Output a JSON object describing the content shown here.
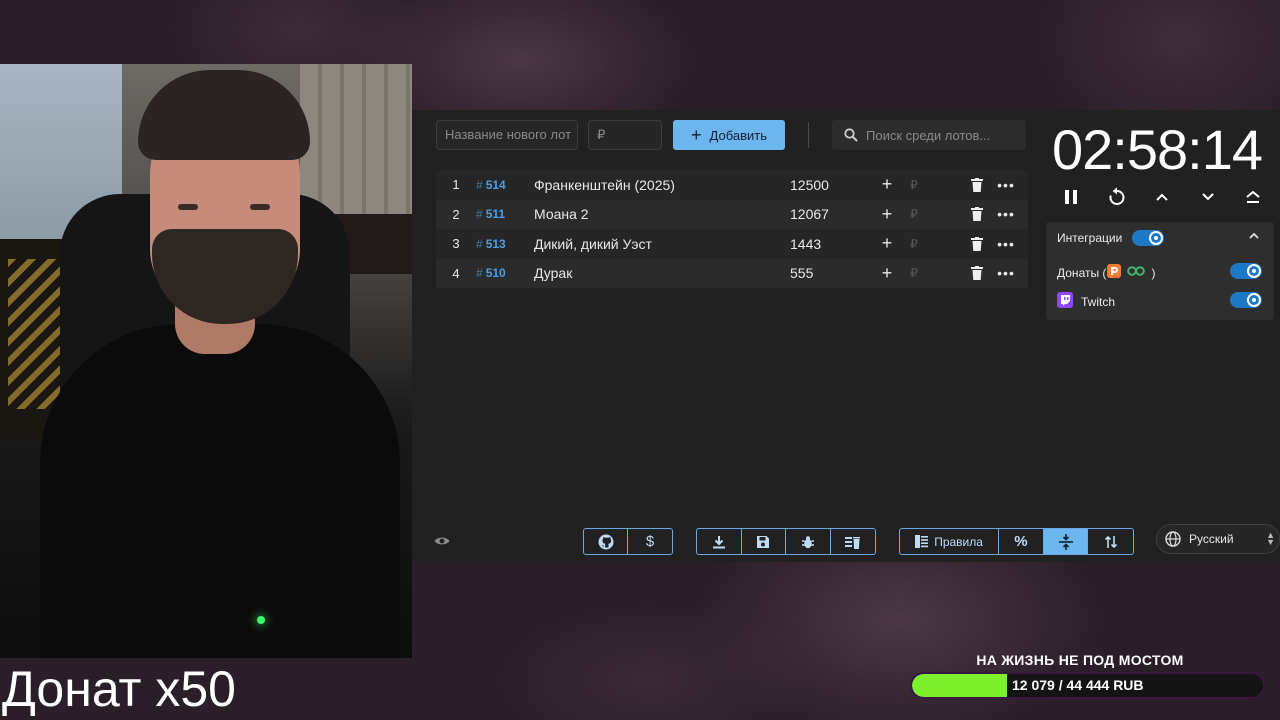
{
  "caption": "Донат х50",
  "inputs": {
    "lot_name_placeholder": "Название нового лот",
    "lot_amount_placeholder": "₽",
    "add_label": "Добавить",
    "search_placeholder": "Поиск среди лотов..."
  },
  "lots": [
    {
      "index": "1",
      "id": "514",
      "name": "Франкенштейн (2025)",
      "amount": "12500"
    },
    {
      "index": "2",
      "id": "511",
      "name": "Моана 2",
      "amount": "12067"
    },
    {
      "index": "3",
      "id": "513",
      "name": "Дикий, дикий Уэст",
      "amount": "1443"
    },
    {
      "index": "4",
      "id": "510",
      "name": "Дурак",
      "amount": "555"
    }
  ],
  "lot_currency": "₽",
  "timer": "02:58:14",
  "integrations": {
    "header": "Интеграции",
    "donations_label": "Донаты (",
    "donations_close": ")",
    "twitch_label": "Twitch"
  },
  "toolbar": {
    "rules_label": "Правила",
    "percent_label": "%"
  },
  "language": "Русский",
  "goal": {
    "title": "НА ЖИЗНЬ НЕ ПОД МОСТОМ",
    "text": "12 079 / 44 444 RUB",
    "progress": 0.2718
  },
  "colors": {
    "accent": "#6cb6f0",
    "lot_id": "#4a9ee8",
    "goal_fill": "#7cf02d",
    "twitch": "#9146ff",
    "donationalerts": "#f57c35"
  }
}
